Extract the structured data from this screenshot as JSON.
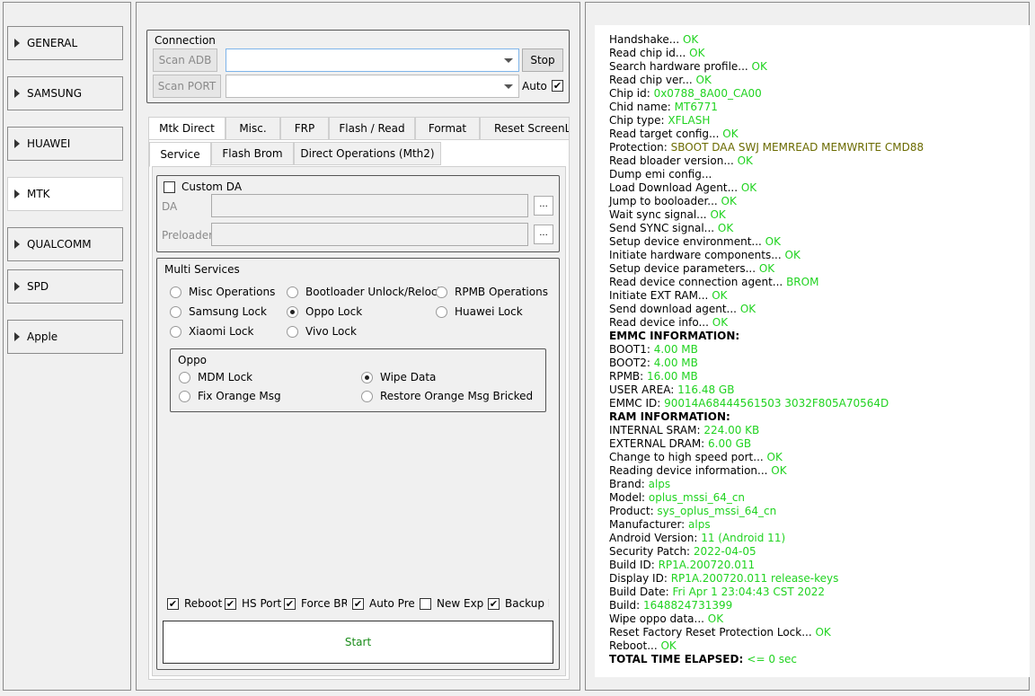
{
  "colors": {
    "ok": "#21d321",
    "warn": "#6b6b00"
  },
  "sidebar": {
    "items": [
      {
        "label": "GENERAL",
        "active": false
      },
      {
        "label": "SAMSUNG",
        "active": false
      },
      {
        "label": "HUAWEI",
        "active": false
      },
      {
        "label": "MTK",
        "active": true
      },
      {
        "label": "QUALCOMM",
        "active": false
      },
      {
        "label": "SPD",
        "active": false
      },
      {
        "label": "Apple",
        "active": false
      }
    ]
  },
  "connection": {
    "title": "Connection",
    "scan_adb": "Scan ADB",
    "scan_port": "Scan PORT",
    "stop": "Stop",
    "auto": "Auto",
    "auto_checked": true
  },
  "tabs": [
    "Mtk Direct",
    "Misc.",
    "FRP",
    "Flash / Read",
    "Format",
    "Reset ScreenLoc"
  ],
  "subtabs": [
    "Service",
    "Flash Brom",
    "Direct Operations (Mth2)"
  ],
  "da": {
    "custom_da": "Custom DA",
    "da_label": "DA",
    "preloader_label": "Preloader",
    "dots": "..."
  },
  "multi": {
    "title": "Multi Services",
    "options": [
      {
        "label": "Misc Operations",
        "on": false
      },
      {
        "label": "Bootloader Unlock/Relock",
        "on": false
      },
      {
        "label": "RPMB Operations",
        "on": false
      },
      {
        "label": "Samsung Lock",
        "on": false
      },
      {
        "label": "Oppo Lock",
        "on": true
      },
      {
        "label": "Huawei Lock",
        "on": false
      },
      {
        "label": "Xiaomi Lock",
        "on": false
      },
      {
        "label": "Vivo Lock",
        "on": false
      }
    ]
  },
  "oppo": {
    "title": "Oppo",
    "options": [
      {
        "label": "MDM Lock",
        "on": false
      },
      {
        "label": "Wipe Data",
        "on": true
      },
      {
        "label": "Fix Orange Msg",
        "on": false
      },
      {
        "label": "Restore Orange Msg Bricked",
        "on": false
      }
    ]
  },
  "checks": [
    {
      "label": "Reboot",
      "on": true
    },
    {
      "label": "HS Port",
      "on": true
    },
    {
      "label": "Force BROM",
      "on": true
    },
    {
      "label": "Auto Preloader",
      "on": true
    },
    {
      "label": "New Exploit",
      "on": false
    },
    {
      "label": "Backup FRP",
      "on": true
    }
  ],
  "start": "Start",
  "log": [
    {
      "k": "Handshake... ",
      "v": "OK"
    },
    {
      "k": "Read chip id... ",
      "v": "OK"
    },
    {
      "k": "Search hardware profile... ",
      "v": "OK"
    },
    {
      "k": "Read chip ver... ",
      "v": "OK"
    },
    {
      "k": "Chip id: ",
      "v": "0x0788_8A00_CA00"
    },
    {
      "k": "Chid name: ",
      "v": "MT6771"
    },
    {
      "k": "Chip type: ",
      "v": "XFLASH"
    },
    {
      "k": "Read target config... ",
      "v": "OK"
    },
    {
      "k": "Protection: ",
      "v": "SBOOT DAA SWJ MEMREAD MEMWRITE CMD88",
      "warn": true
    },
    {
      "k": "Read bloader version... ",
      "v": "OK"
    },
    {
      "k": "Dump emi config... ",
      "v": ""
    },
    {
      "k": "Load Download Agent... ",
      "v": "OK"
    },
    {
      "k": "Jump to booloader... ",
      "v": "OK"
    },
    {
      "k": "Wait sync signal... ",
      "v": "OK"
    },
    {
      "k": "Send SYNC signal... ",
      "v": "OK"
    },
    {
      "k": "Setup device environment... ",
      "v": "OK"
    },
    {
      "k": "Initiate hardware components... ",
      "v": "OK"
    },
    {
      "k": "Setup device parameters... ",
      "v": "OK"
    },
    {
      "k": "Read device connection agent... ",
      "v": "BROM"
    },
    {
      "k": "Initiate EXT RAM... ",
      "v": "OK"
    },
    {
      "k": "Send download agent... ",
      "v": "OK"
    },
    {
      "k": "Read device info... ",
      "v": "OK"
    },
    {
      "k": "EMMC INFORMATION:",
      "v": "",
      "bold": true
    },
    {
      "k": "BOOT1: ",
      "v": "4.00 MB"
    },
    {
      "k": "BOOT2: ",
      "v": "4.00 MB"
    },
    {
      "k": "RPMB: ",
      "v": "16.00 MB"
    },
    {
      "k": "USER AREA: ",
      "v": "116.48 GB"
    },
    {
      "k": "EMMC ID: ",
      "v": "90014A68444561503 3032F805A70564D"
    },
    {
      "k": "RAM INFORMATION:",
      "v": "",
      "bold": true
    },
    {
      "k": "INTERNAL SRAM: ",
      "v": "224.00 KB"
    },
    {
      "k": "EXTERNAL DRAM: ",
      "v": "6.00 GB"
    },
    {
      "k": "Change to high speed port... ",
      "v": "OK"
    },
    {
      "k": "Reading device information... ",
      "v": "OK"
    },
    {
      "k": " Brand: ",
      "v": "alps"
    },
    {
      "k": " Model: ",
      "v": "oplus_mssi_64_cn"
    },
    {
      "k": " Product: ",
      "v": "sys_oplus_mssi_64_cn"
    },
    {
      "k": " Manufacturer: ",
      "v": "alps"
    },
    {
      "k": " Android Version: ",
      "v": "11 (Android 11)"
    },
    {
      "k": " Security Patch: ",
      "v": "2022-04-05"
    },
    {
      "k": " Build ID: ",
      "v": "RP1A.200720.011"
    },
    {
      "k": " Display ID: ",
      "v": "RP1A.200720.011 release-keys"
    },
    {
      "k": " Build Date: ",
      "v": "Fri Apr  1 23:04:43 CST 2022"
    },
    {
      "k": " Build: ",
      "v": "1648824731399"
    },
    {
      "k": "Wipe oppo data... ",
      "v": "OK"
    },
    {
      "k": "Reset Factory Reset Protection Lock... ",
      "v": "OK"
    },
    {
      "k": " Reboot... ",
      "v": "OK"
    },
    {
      "k": " TOTAL TIME ELAPSED: ",
      "v": "<= 0 sec",
      "bold": true
    }
  ]
}
